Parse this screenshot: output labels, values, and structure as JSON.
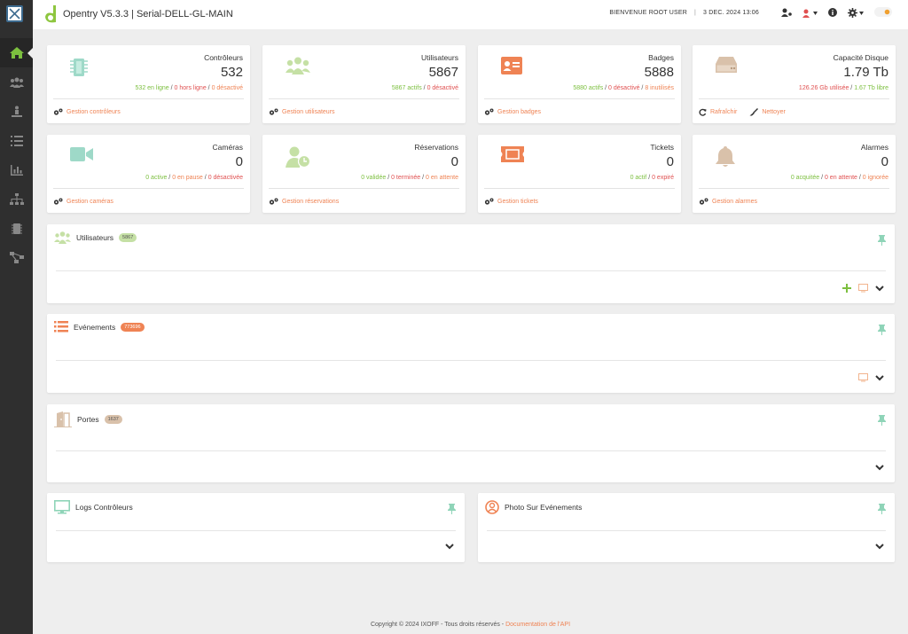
{
  "app": {
    "title": "Opentry V5.3.3 | Serial-DELL-GL-MAIN",
    "welcome": "BIENVENUE ROOT USER",
    "separator": "|",
    "date": "3 DEC. 2024 13:06"
  },
  "colors": {
    "accent": "#ef8354",
    "green": "#7cbf3f",
    "red": "#e05050",
    "sidebar": "#2f2f2f"
  },
  "cards": [
    {
      "title": "Contrôleurs",
      "value": "532",
      "stats": [
        [
          "532 en ligne",
          "green"
        ],
        [
          " / ",
          ""
        ],
        [
          "0 hors ligne",
          "red"
        ],
        [
          " / ",
          ""
        ],
        [
          "0 désactivé",
          "orange"
        ]
      ],
      "foot": "Gestion contrôleurs",
      "icon": "chip-icon"
    },
    {
      "title": "Utilisateurs",
      "value": "5867",
      "stats": [
        [
          "5867 actifs",
          "green"
        ],
        [
          " / ",
          ""
        ],
        [
          "0 désactivé",
          "red"
        ]
      ],
      "foot": "Gestion utilisateurs",
      "icon": "users-icon"
    },
    {
      "title": "Badges",
      "value": "5888",
      "stats": [
        [
          "5880 actifs",
          "green"
        ],
        [
          " / ",
          ""
        ],
        [
          "0 désactivé",
          "red"
        ],
        [
          " / ",
          ""
        ],
        [
          "8 inutilisés",
          "orange"
        ]
      ],
      "foot": "Gestion badges",
      "icon": "id-card-icon"
    },
    {
      "title": "Capacité Disque",
      "value": "1.79 Tb",
      "stats": [
        [
          "126.26 Gb utilisée",
          "red"
        ],
        [
          " / ",
          ""
        ],
        [
          "1.67 Tb libre",
          "green"
        ]
      ],
      "foot": "Rafraîchir",
      "foot2": "Nettoyer",
      "icon": "hdd-icon"
    },
    {
      "title": "Caméras",
      "value": "0",
      "stats": [
        [
          "0 active",
          "green"
        ],
        [
          " / ",
          ""
        ],
        [
          "0 en pause",
          "orange"
        ],
        [
          " / ",
          ""
        ],
        [
          "0 désactivée",
          "red"
        ]
      ],
      "foot": "Gestion caméras",
      "icon": "camera-icon"
    },
    {
      "title": "Réservations",
      "value": "0",
      "stats": [
        [
          "0 validée",
          "green"
        ],
        [
          " / ",
          ""
        ],
        [
          "0 terminée",
          "red"
        ],
        [
          " / ",
          ""
        ],
        [
          "0 en attente",
          "orange"
        ]
      ],
      "foot": "Gestion réservations",
      "icon": "user-clock-icon"
    },
    {
      "title": "Tickets",
      "value": "0",
      "stats": [
        [
          "0 actif",
          "green"
        ],
        [
          " / ",
          ""
        ],
        [
          "0 expiré",
          "red"
        ]
      ],
      "foot": "Gestion tickets",
      "icon": "ticket-icon"
    },
    {
      "title": "Alarmes",
      "value": "0",
      "stats": [
        [
          "0 acquitée",
          "green"
        ],
        [
          " / ",
          ""
        ],
        [
          "0 en attente",
          "red"
        ],
        [
          " / ",
          ""
        ],
        [
          "0 ignorée",
          "orange"
        ]
      ],
      "foot": "Gestion alarmes",
      "icon": "bell-icon"
    }
  ],
  "panels": {
    "users": {
      "title": "Utilisateurs",
      "count": "5867"
    },
    "events": {
      "title": "Evénements",
      "count": "773696"
    },
    "doors": {
      "title": "Portes",
      "count": "1637"
    },
    "logs": {
      "title": "Logs Contrôleurs"
    },
    "photo": {
      "title": "Photo Sur Evénements"
    }
  },
  "footer": {
    "copyright": "Copyright © 2024 IXOFF - Tous droits réservés - ",
    "doc_link": "Documentation de l'API"
  }
}
